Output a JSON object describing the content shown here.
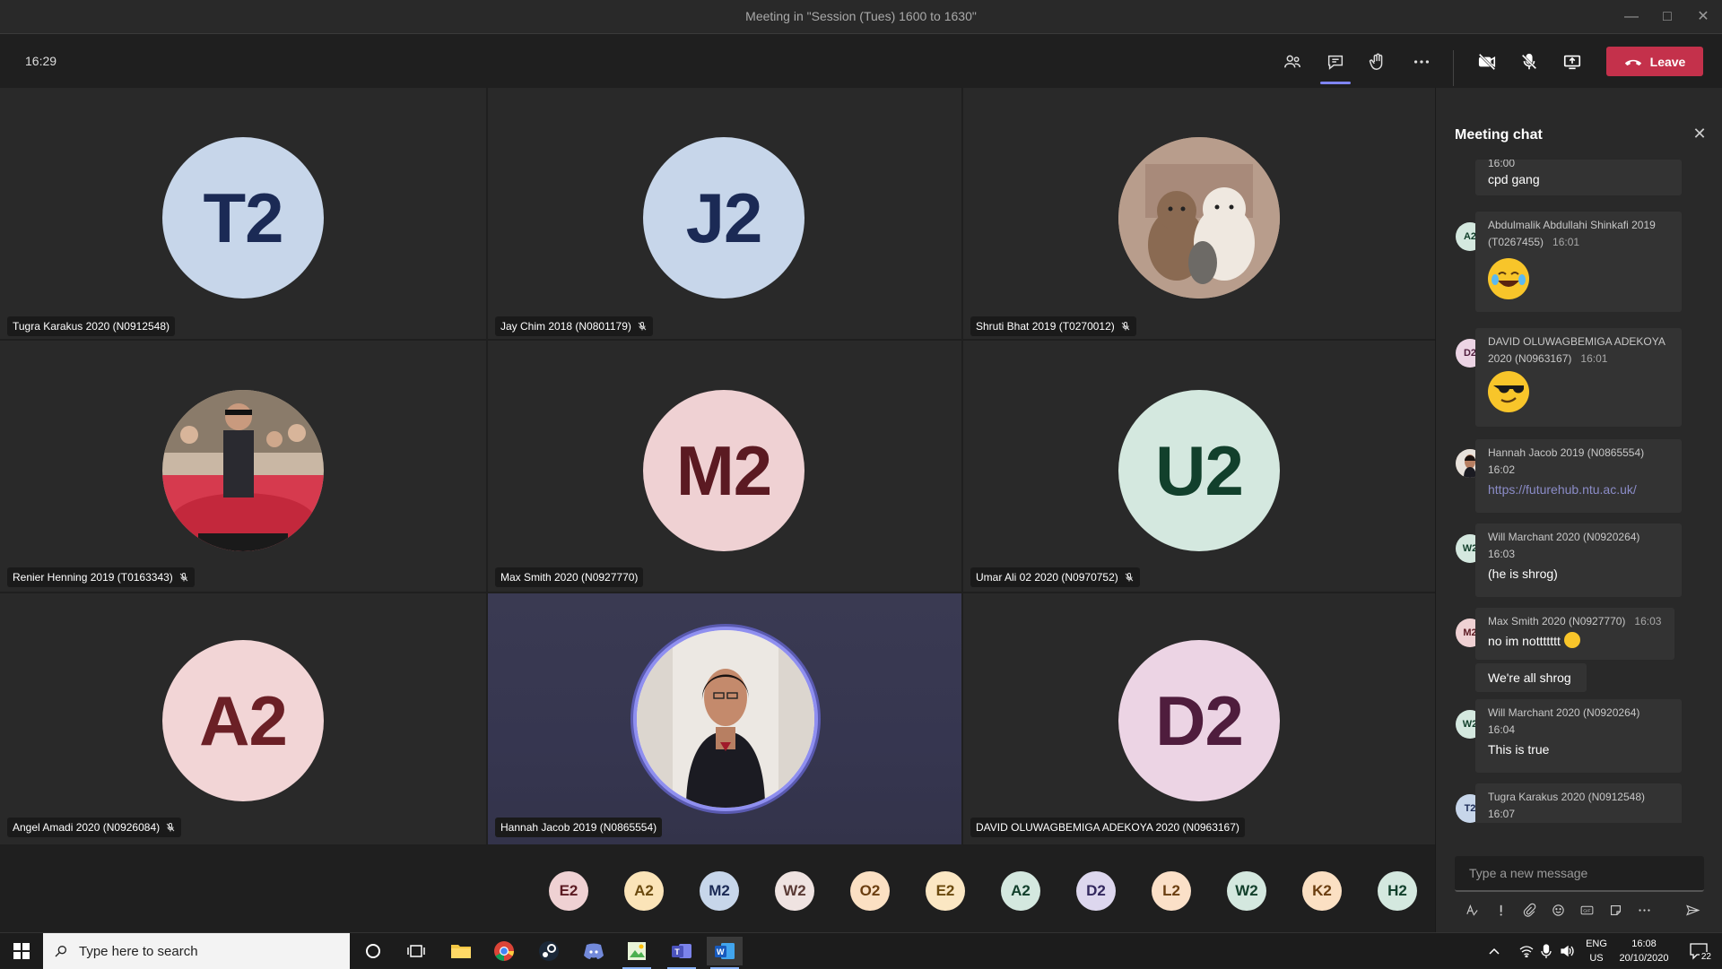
{
  "window": {
    "title": "Meeting in \"Session (Tues) 1600 to 1630\""
  },
  "toolbar": {
    "clock": "16:29",
    "leave_label": "Leave"
  },
  "tiles": [
    {
      "initials": "T2",
      "name": "Tugra Karakus 2020 (N0912548)",
      "muted": false,
      "avatar_bg": "#c7d6ea",
      "avatar_fg": "#1b2a55",
      "photo": false
    },
    {
      "initials": "J2",
      "name": "Jay Chim 2018 (N0801179)",
      "muted": true,
      "avatar_bg": "#c7d6ea",
      "avatar_fg": "#1b2a55",
      "photo": false
    },
    {
      "initials": "",
      "name": "Shruti Bhat 2019 (T0270012)",
      "muted": true,
      "avatar_bg": "#b59a8a",
      "avatar_fg": "#000",
      "photo": true
    },
    {
      "initials": "",
      "name": "Renier Henning 2019 (T0163343)",
      "muted": true,
      "avatar_bg": "#8a6b66",
      "avatar_fg": "#000",
      "photo": true
    },
    {
      "initials": "M2",
      "name": "Max Smith 2020 (N0927770)",
      "muted": false,
      "avatar_bg": "#efd1d3",
      "avatar_fg": "#5b1a22",
      "photo": false
    },
    {
      "initials": "U2",
      "name": "Umar Ali 02 2020 (N0970752)",
      "muted": true,
      "avatar_bg": "#d4e8df",
      "avatar_fg": "#12402c",
      "photo": false
    },
    {
      "initials": "A2",
      "name": "Angel Amadi 2020 (N0926084)",
      "muted": true,
      "avatar_bg": "#f2d5d6",
      "avatar_fg": "#6b2026",
      "photo": false
    },
    {
      "initials": "",
      "name": "Hannah Jacob 2019 (N0865554)",
      "muted": false,
      "avatar_bg": "#eeeae6",
      "avatar_fg": "#000",
      "photo": true,
      "speaking": true
    },
    {
      "initials": "D2",
      "name": "DAVID OLUWAGBEMIGA ADEKOYA 2020 (N0963167)",
      "muted": false,
      "avatar_bg": "#ecd4e4",
      "avatar_fg": "#4f1d3d",
      "photo": false
    }
  ],
  "roster": [
    {
      "initials": "E2",
      "bg": "#efd1d3",
      "fg": "#5b1a22"
    },
    {
      "initials": "A2",
      "bg": "#fbe4b8",
      "fg": "#6b4a0e"
    },
    {
      "initials": "M2",
      "bg": "#c7d6ea",
      "fg": "#1b2a55"
    },
    {
      "initials": "W2",
      "bg": "#efe3e1",
      "fg": "#5a3a35"
    },
    {
      "initials": "O2",
      "bg": "#fbe0c3",
      "fg": "#6b3e10"
    },
    {
      "initials": "E2",
      "bg": "#fbe7c3",
      "fg": "#6b4a0e"
    },
    {
      "initials": "A2",
      "bg": "#d4e8df",
      "fg": "#12402c"
    },
    {
      "initials": "D2",
      "bg": "#ddd7ee",
      "fg": "#33285e"
    },
    {
      "initials": "L2",
      "bg": "#fbe0c8",
      "fg": "#6b3e10"
    },
    {
      "initials": "W2",
      "bg": "#d4e8df",
      "fg": "#12402c"
    },
    {
      "initials": "K2",
      "bg": "#fbe0c3",
      "fg": "#6b3e10"
    },
    {
      "initials": "H2",
      "bg": "#d4e8df",
      "fg": "#12402c"
    }
  ],
  "chat": {
    "title": "Meeting chat",
    "placeholder": "Type a new message",
    "messages": [
      {
        "avatar": "",
        "sender": "",
        "time": "16:00",
        "body": "cpd gang",
        "type": "text"
      },
      {
        "avatar": "A2",
        "avatar_bg": "#d4e8df",
        "avatar_fg": "#12402c",
        "sender": "Abdulmalik Abdullahi Shinkafi 2019 (T0267455)",
        "time": "16:01",
        "body": "",
        "emoji": "laughing-tears",
        "type": "emoji"
      },
      {
        "avatar": "D2",
        "avatar_bg": "#ecd4e4",
        "avatar_fg": "#4f1d3d",
        "sender": "DAVID OLUWAGBEMIGA ADEKOYA 2020 (N0963167)",
        "time": "16:01",
        "body": "",
        "emoji": "sunglasses",
        "type": "emoji"
      },
      {
        "avatar": "",
        "avatar_bg": "#6b4a3a",
        "avatar_fg": "#fff",
        "sender": "Hannah Jacob 2019 (N0865554)",
        "time": "16:02",
        "body": "https://futurehub.ntu.ac.uk/",
        "type": "link"
      },
      {
        "avatar": "W2",
        "avatar_bg": "#d4e8df",
        "avatar_fg": "#12402c",
        "sender": "Will Marchant 2020 (N0920264)",
        "time": "16:03",
        "body": "(he is shrog)",
        "type": "text"
      },
      {
        "avatar": "M2",
        "avatar_bg": "#efd1d3",
        "avatar_fg": "#5b1a22",
        "sender": "Max Smith 2020 (N0927770)",
        "time": "16:03",
        "body": "no im nottttttt",
        "extra": "We're all shrog",
        "type": "text"
      },
      {
        "avatar": "W2",
        "avatar_bg": "#d4e8df",
        "avatar_fg": "#12402c",
        "sender": "Will Marchant 2020 (N0920264)",
        "time": "16:04",
        "body": "This is true",
        "type": "text"
      },
      {
        "avatar": "T2",
        "avatar_bg": "#c7d6ea",
        "avatar_fg": "#1b2a55",
        "sender": "Tugra Karakus 2020 (N0912548)",
        "time": "16:07",
        "body": "",
        "type": "text"
      }
    ]
  },
  "taskbar": {
    "search_placeholder": "Type here to search",
    "lang_top": "ENG",
    "lang_bottom": "US",
    "time": "16:08",
    "date": "20/10/2020",
    "notifications": "22"
  },
  "colors": {
    "accent": "#7f85f5",
    "leave": "#c4314b"
  }
}
